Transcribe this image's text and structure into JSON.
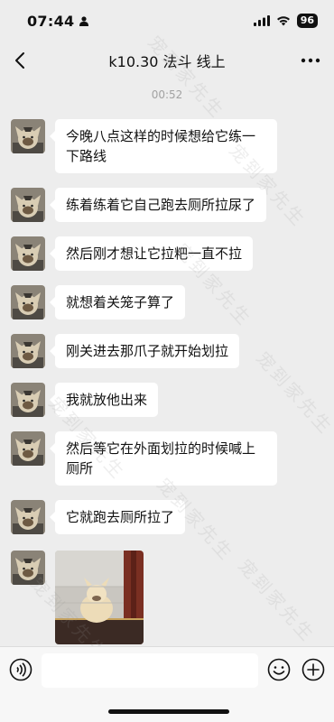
{
  "status_bar": {
    "time": "07:44",
    "battery": "96"
  },
  "header": {
    "title": "k10.30 法斗 线上",
    "back_icon": "chevron-left-icon",
    "more_icon": "more-dots-icon"
  },
  "chat": {
    "timestamp": "00:52",
    "messages": [
      {
        "type": "text",
        "text": "今晚八点这样的时候想给它练一下路线"
      },
      {
        "type": "text",
        "text": "练着练着它自己跑去厕所拉尿了"
      },
      {
        "type": "text",
        "text": "然后刚才想让它拉粑一直不拉"
      },
      {
        "type": "text",
        "text": "就想着关笼子算了"
      },
      {
        "type": "text",
        "text": "刚关进去那爪子就开始划拉"
      },
      {
        "type": "text",
        "text": "我就放他出来"
      },
      {
        "type": "text",
        "text": "然后等它在外面划拉的时候喊上厕所"
      },
      {
        "type": "text",
        "text": "它就跑去厕所拉了"
      },
      {
        "type": "image"
      }
    ]
  },
  "input_bar": {
    "value": "",
    "voice_icon": "voice-icon",
    "emoji_icon": "emoji-icon",
    "plus_icon": "plus-icon"
  },
  "watermark": "宠到家先生"
}
